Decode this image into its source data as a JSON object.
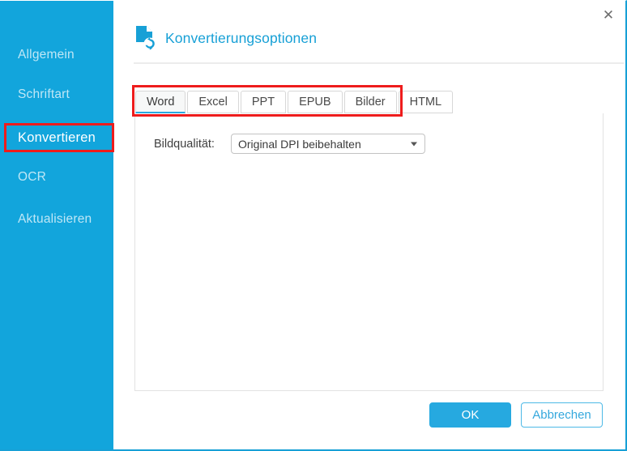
{
  "window": {
    "close_label": "✕",
    "accent_color": "#12a5dc",
    "border_color": "#17a0d6"
  },
  "sidebar": {
    "background_color": "#12a5dc",
    "items": [
      {
        "label": "Allgemein",
        "selected": false
      },
      {
        "label": "Schriftart",
        "selected": false
      },
      {
        "label": "Konvertieren",
        "selected": true
      },
      {
        "label": "OCR",
        "selected": false
      },
      {
        "label": "Aktualisieren",
        "selected": false
      }
    ]
  },
  "dialog": {
    "title": "Konvertierungsoptionen",
    "title_color": "#17a0d6",
    "icon": "document-convert-icon"
  },
  "tabs": [
    {
      "label": "Word",
      "active": true
    },
    {
      "label": "Excel",
      "active": false
    },
    {
      "label": "PPT",
      "active": false
    },
    {
      "label": "EPUB",
      "active": false
    },
    {
      "label": "Bilder",
      "active": false
    },
    {
      "label": "HTML",
      "active": false
    }
  ],
  "form": {
    "image_quality": {
      "label": "Bildqualität:",
      "value": "Original DPI beibehalten"
    }
  },
  "footer": {
    "ok_label": "OK",
    "cancel_label": "Abbrechen",
    "ok_color": "#26a9e0",
    "cancel_color": "#35a8dd"
  },
  "annotations": {
    "highlight_color": "#ee1c1c",
    "boxes": [
      {
        "target": "sidebar-item-konvertieren"
      },
      {
        "target": "tab-bar"
      }
    ]
  }
}
